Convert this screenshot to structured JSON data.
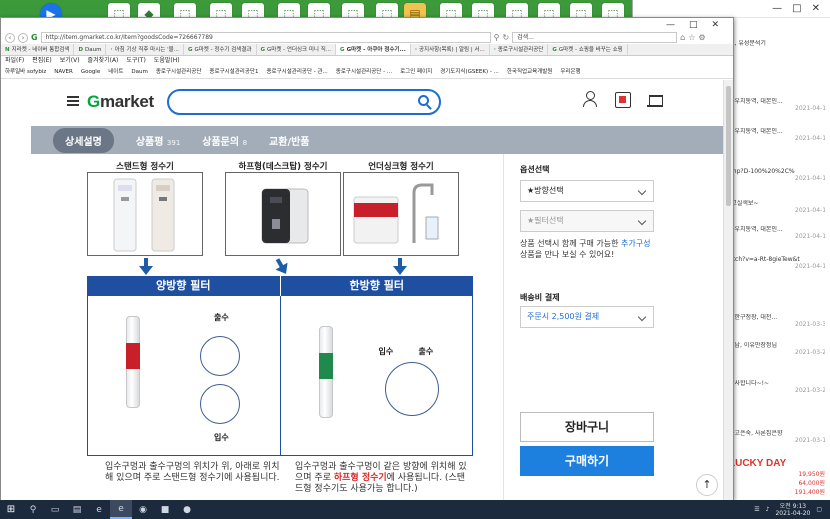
{
  "browser": {
    "url": "http://item.gmarket.co.kr/Item?goodsCode=726667789",
    "search_placeholder": "검색...",
    "tabs": [
      {
        "label": "지라켓 - 네이버 통합검색"
      },
      {
        "label": "Daum"
      },
      {
        "label": "아침 기상 직후 마시는 '물..."
      },
      {
        "label": "G마켓 - 정수기 검색결과"
      },
      {
        "label": "G마켓 - 언더싱크 미니 직..."
      },
      {
        "label": "G마켓 - 아쿠아 정수기..."
      },
      {
        "label": "공지사항(목록) | 알림 | 서..."
      },
      {
        "label": "종로구시설관리공단"
      },
      {
        "label": "G마켓 - 쇼핑을 바꾸는 쇼핑"
      }
    ],
    "menu": [
      "파일(F)",
      "편집(E)",
      "보기(V)",
      "즐겨찾기(A)",
      "도구(T)",
      "도움말(H)"
    ],
    "bookmarks": [
      "하루일바 sofybiz",
      "NAVER",
      "Google",
      "네이트",
      "Daum",
      "종로구시설관리공단",
      "종로구시설관리공단1",
      "종로구시설관리공단 - 관...",
      "종로구시설관리공단 - ...",
      "로그인 페이지",
      "경기도지식(GSEEK) - ...",
      "한국직업교육개발원",
      "우리은행"
    ]
  },
  "gmarket": {
    "logo": "Gmarket",
    "logo_g": "G",
    "logo_rest": "market",
    "detail_tabs": [
      {
        "label": "상세설명"
      },
      {
        "label": "상품평",
        "count": "391"
      },
      {
        "label": "상품문의",
        "count": "8"
      },
      {
        "label": "교환/반품"
      }
    ]
  },
  "content": {
    "products": [
      {
        "title": "스탠드형 정수기"
      },
      {
        "title": "하프형(데스크탑) 정수기"
      },
      {
        "title": "언더싱크형 정수기"
      }
    ],
    "filter_left_title": "양방향 필터",
    "filter_right_title": "한방향 필터",
    "label_out": "출수",
    "label_in": "입수",
    "label_in_right": "입수",
    "label_out_right": "출수",
    "desc_left": "입수구멍과 출수구멍의 위치가 위, 아래로 위치해 있으며 주로 스탠드형 정수기에 사용됩니다.",
    "desc_right_pre": "입수구멍과 출수구멍이 같은 방향에 위치해 있으며 주로 ",
    "desc_right_red": "하프형 정수기",
    "desc_right_post": "에 사용됩니다. (스탠드형 정수기도 사용가능 합니다.)"
  },
  "side": {
    "option_label": "옵션선택",
    "option1": "★방향선택",
    "option2": "★필터선택",
    "note_pre": "상품 선택시 함께 구매 가능한 ",
    "note_blue": "추가구성",
    "note_post": " 상품을 만나 보실 수 있어요!",
    "shipping_label": "배송비 결제",
    "shipping_value": "주문시 2,500원 결제",
    "cart_button": "장바구니",
    "buy_button": "구매하기"
  },
  "bg_window": {
    "rows": [
      {
        "text": "트, 유성분석기",
        "date": ""
      },
      {
        "text": "화우치동역, 대본인...",
        "date": "2021-04-19"
      },
      {
        "text": "화우치동역, 대본인...",
        "date": "2021-04-19"
      },
      {
        "text": "php?D-100%20%2C%",
        "date": "2021-04-19"
      },
      {
        "text": "(고실색보~",
        "date": "2021-04-18"
      },
      {
        "text": "화우치동역, 대본인...",
        "date": "2021-04-17"
      },
      {
        "text": "atch?v=a-Rt-8gieTew&t",
        "date": "2021-04-17"
      },
      {
        "text": "대한구청장, 대천...",
        "date": "2021-03-31"
      },
      {
        "text": "정남, 이유만장정님",
        "date": "2021-03-26"
      },
      {
        "text": "감사합니다~!~",
        "date": "2021-03-25"
      },
      {
        "text": "라고은숙, 사론집은향",
        "date": "2021-03-13"
      }
    ],
    "lucky_day": "LUCKY DAY",
    "prices": [
      "19,950원",
      "64,000원",
      "191,400원"
    ]
  },
  "taskbar": {
    "time": "오전 9:13",
    "date": "2021-04-20"
  }
}
